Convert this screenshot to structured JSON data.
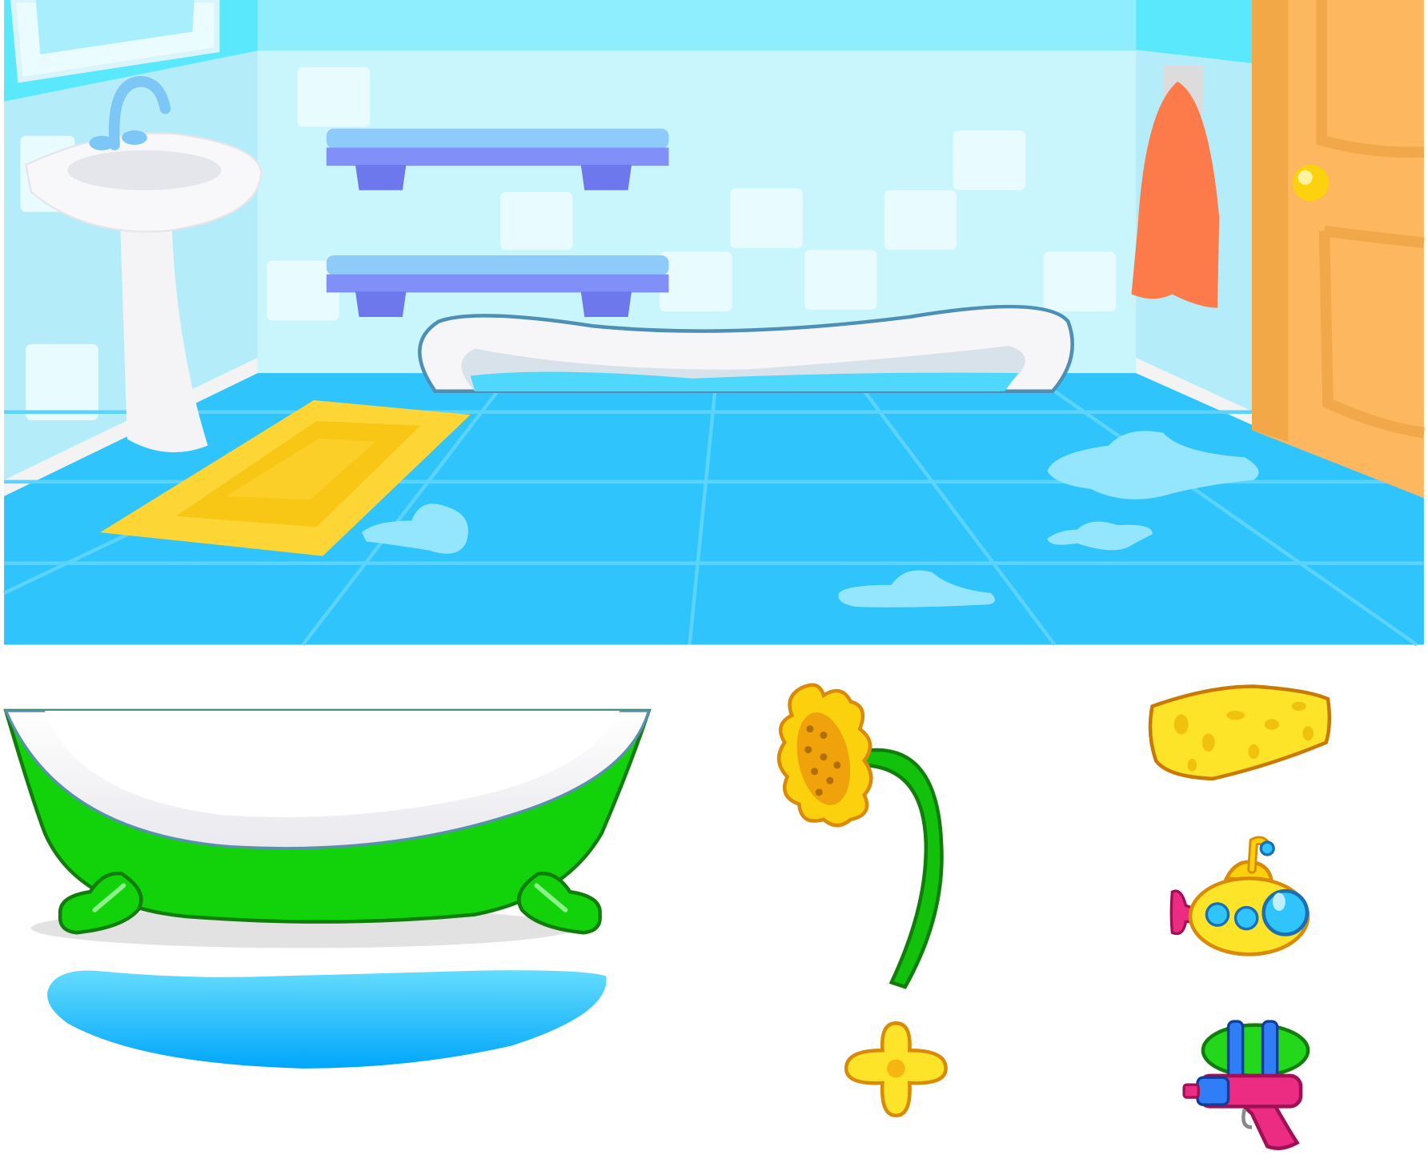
{
  "scene": {
    "name": "bathroom",
    "colors": {
      "back_wall": "#c9f5fd",
      "wall_top": "#8eeefd",
      "side_wall": "#b5ecfa",
      "floor": "#2fc4fc",
      "floor_lines": "#5ad3fd",
      "door": "#fdb75e",
      "rug": "#fdd535",
      "shelf": "#8090f8",
      "towel": "#fd7b4a",
      "puddle": "#93e6fd"
    }
  },
  "assets": [
    {
      "id": "green-bathtub",
      "color": "#12d20a"
    },
    {
      "id": "bath-water",
      "color": "#30c0fc"
    },
    {
      "id": "sunflower-shower-head",
      "color": "#fbd10e"
    },
    {
      "id": "tap-handle",
      "color": "#fde428"
    },
    {
      "id": "sponge",
      "color": "#fde428"
    },
    {
      "id": "toy-submarine",
      "color": "#fde428"
    },
    {
      "id": "water-gun",
      "color": "#ec2b82"
    }
  ]
}
